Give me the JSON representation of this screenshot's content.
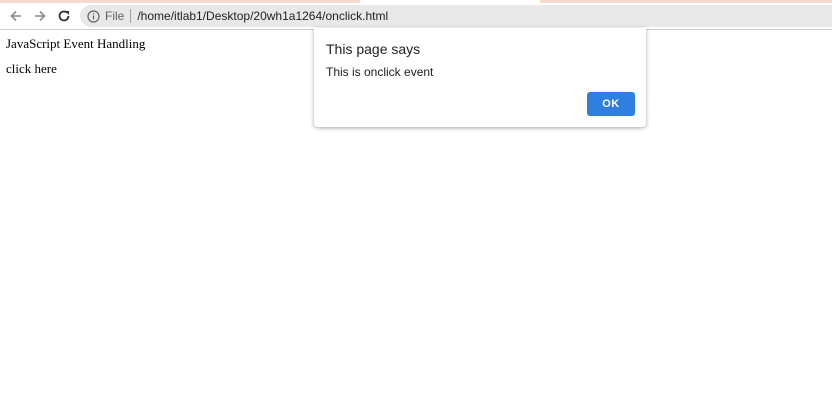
{
  "browser": {
    "scheme_label": "File",
    "url": "/home/itlab1/Desktop/20wh1a1264/onclick.html",
    "icons": {
      "back": "arrow-left-icon",
      "forward": "arrow-right-icon",
      "reload": "reload-icon",
      "info": "info-icon"
    },
    "tab_accent_color": "#f6d9cf"
  },
  "page": {
    "heading": "JavaScript Event Handling",
    "link_text": "click here"
  },
  "dialog": {
    "title": "This page says",
    "message": "This is onclick event",
    "ok_label": "OK",
    "ok_color": "#2f7fe0"
  }
}
